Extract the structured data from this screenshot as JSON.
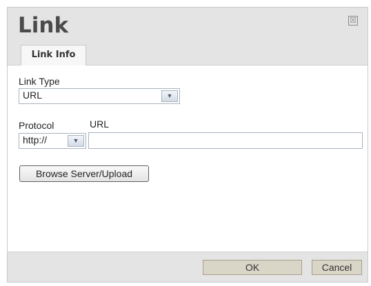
{
  "dialog": {
    "title": "Link",
    "close_glyph": "☒",
    "tabs": [
      {
        "label": "Link Info"
      }
    ]
  },
  "form": {
    "link_type": {
      "label": "Link Type",
      "value": "URL"
    },
    "protocol": {
      "label": "Protocol",
      "value": "http://"
    },
    "url": {
      "label": "URL",
      "value": ""
    },
    "browse_label": "Browse Server/Upload"
  },
  "footer": {
    "ok_label": "OK",
    "cancel_label": "Cancel"
  },
  "icons": {
    "close": "close-icon",
    "dropdown": "chevron-down-icon"
  }
}
